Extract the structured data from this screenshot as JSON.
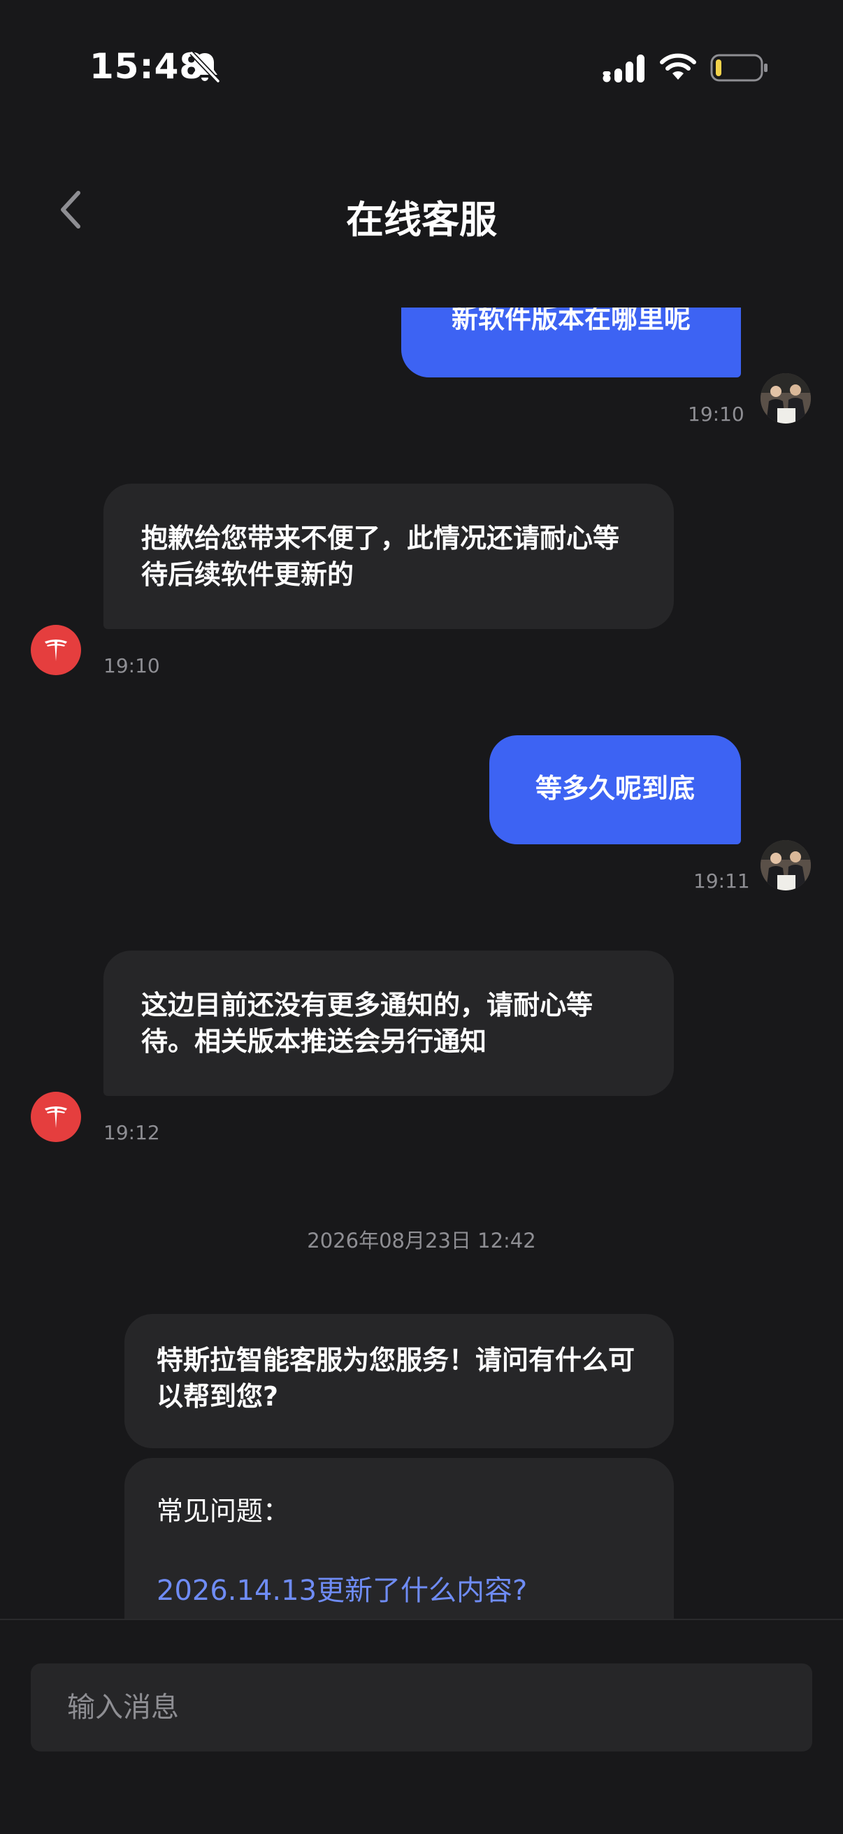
{
  "status_bar": {
    "time": "15:48",
    "icons": [
      "bell-slash-icon",
      "cellular-signal-icon",
      "wifi-icon",
      "battery-icon"
    ],
    "battery_color": "#f2d24b"
  },
  "header": {
    "back_icon": "chevron-left-icon",
    "title": "在线客服"
  },
  "messages": [
    {
      "sender": "user",
      "text": "新软件版本在哪里呢",
      "time": "19:10"
    },
    {
      "sender": "agent",
      "text": "抱歉给您带来不便了，此情况还请耐心等待后续软件更新的",
      "time": "19:10"
    },
    {
      "sender": "user",
      "text": "等多久呢到底",
      "time": "19:11"
    },
    {
      "sender": "agent",
      "text": "这边目前还没有更多通知的，请耐心等待。相关版本推送会另行通知",
      "time": "19:12"
    }
  ],
  "date_divider": "2026年08月23日 12:42",
  "bot_greeting": "特斯拉智能客服为您服务！请问有什么可以帮到您?",
  "faq": {
    "title": "常见问题：",
    "items": [
      "2026.14.13更新了什么内容?"
    ]
  },
  "input": {
    "placeholder": "输入消息",
    "value": ""
  },
  "colors": {
    "background": "#18181a",
    "user_bubble": "#3d63f3",
    "agent_bubble": "#262628",
    "link": "#6f8cf5",
    "brand_red": "#e53e3e",
    "timestamp": "#8e8e93"
  }
}
